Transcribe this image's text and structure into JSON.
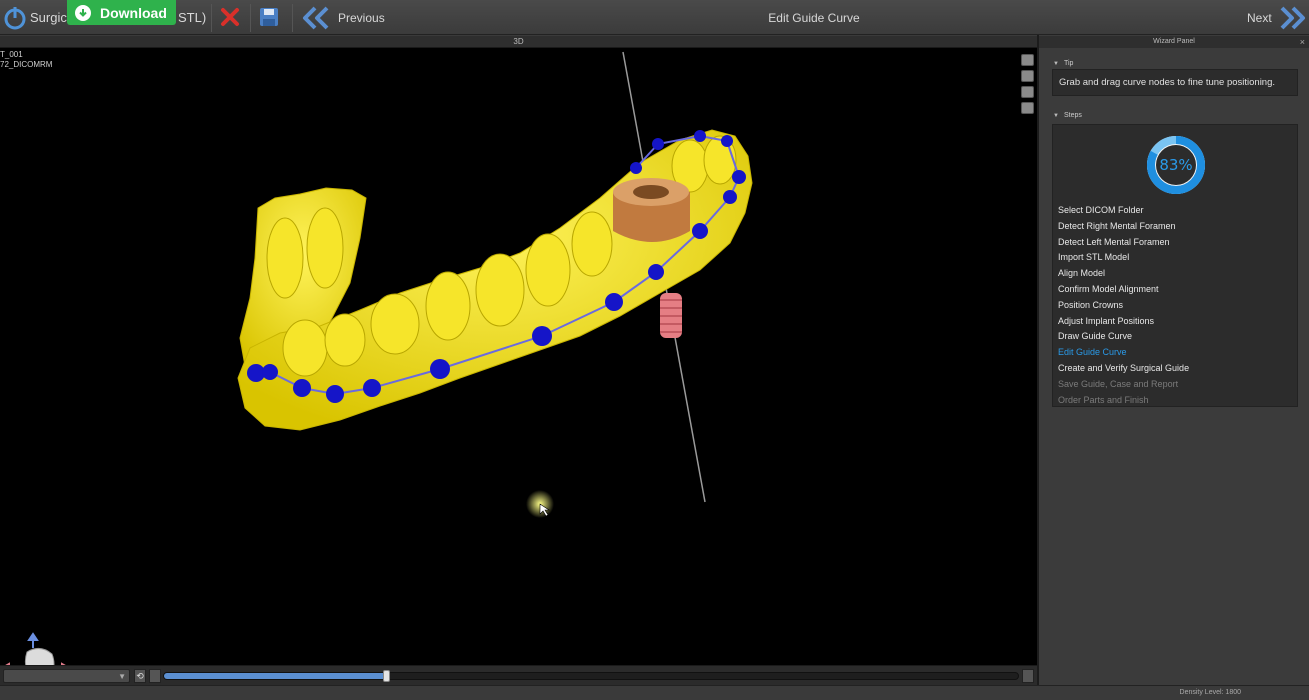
{
  "toolbar": {
    "app_label": "Surgica",
    "download_label": "Download",
    "project_suffix": "STL)",
    "previous_label": "Previous",
    "title": "Edit Guide Curve",
    "next_label": "Next"
  },
  "view": {
    "header_label": "3D",
    "info_line1": "T_001",
    "info_line2": "72_DICOMRM",
    "scan_slider_fraction": 0.26
  },
  "status": {
    "density_label": "Density Level: 1800"
  },
  "wizard": {
    "panel_title": "Wizard Panel",
    "close_glyph": "×",
    "tip_title": "Tip",
    "tip_text": "Grab and drag curve nodes to fine tune positioning.",
    "steps_title": "Steps",
    "progress_percent": 83,
    "progress_label": "83%",
    "steps": [
      {
        "label": "Select DICOM Folder",
        "state": "done"
      },
      {
        "label": "Detect Right Mental Foramen",
        "state": "done"
      },
      {
        "label": "Detect Left Mental Foramen",
        "state": "done"
      },
      {
        "label": "Import STL Model",
        "state": "done"
      },
      {
        "label": "Align Model",
        "state": "done"
      },
      {
        "label": "Confirm Model Alignment",
        "state": "done"
      },
      {
        "label": "Position Crowns",
        "state": "done"
      },
      {
        "label": "Adjust Implant Positions",
        "state": "done"
      },
      {
        "label": "Draw Guide Curve",
        "state": "done"
      },
      {
        "label": "Edit Guide Curve",
        "state": "current"
      },
      {
        "label": "Create and Verify Surgical Guide",
        "state": "done"
      },
      {
        "label": "Save Guide, Case and Report",
        "state": "pending"
      },
      {
        "label": "Order Parts and Finish",
        "state": "pending"
      }
    ]
  },
  "colors": {
    "accent": "#2a9ae8",
    "model": "#f2e21a",
    "curve_nodes": "#1515c8",
    "download": "#2fb24c"
  },
  "icons": {
    "power": "power-icon",
    "download": "download-icon",
    "close": "close-icon",
    "save": "save-icon",
    "previous": "double-chevron-left-icon",
    "next": "double-chevron-right-icon"
  }
}
